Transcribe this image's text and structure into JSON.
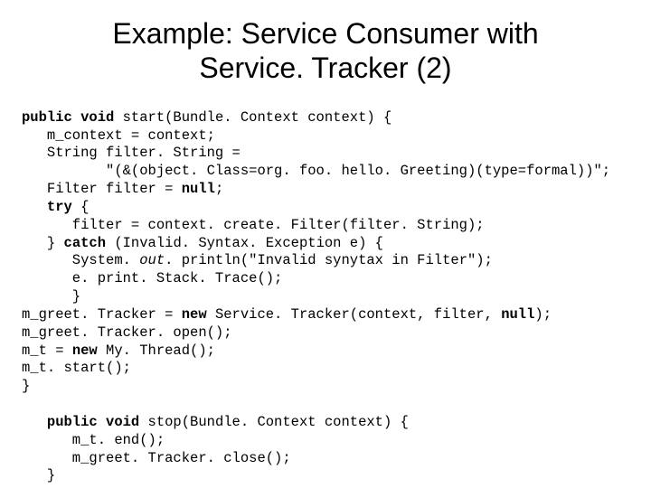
{
  "title_line1": "Example: Service Consumer with",
  "title_line2": "Service. Tracker (2)",
  "code": {
    "l01a": "public void ",
    "l01b": "start(Bundle. Context context) {",
    "l02": "   m_context = context;",
    "l03": "   String filter. String =",
    "l04": "          \"(&(object. Class=org. foo. hello. Greeting)(type=formal))\";",
    "l05a": "   Filter filter = ",
    "l05b": "null",
    "l05c": ";",
    "l06a": "   try",
    "l06b": " {",
    "l07": "      filter = context. create. Filter(filter. String);",
    "l08a": "   } ",
    "l08b": "catch",
    "l08c": " (Invalid. Syntax. Exception e) {",
    "l09a": "      System. ",
    "l09b": "out",
    "l09c": ". println(\"Invalid synytax in Filter\");",
    "l10": "      e. print. Stack. Trace();",
    "l11": "      }",
    "l12a": "m_greet. Tracker = ",
    "l12b": "new",
    "l12c": " Service. Tracker(context, filter, ",
    "l12d": "null",
    "l12e": ");",
    "l13": "m_greet. Tracker. open();",
    "l14a": "m_t = ",
    "l14b": "new",
    "l14c": " My. Thread();",
    "l15": "m_t. start();",
    "l16": "}",
    "l17": "",
    "l18a": "   public void ",
    "l18b": "stop(Bundle. Context context) {",
    "l19": "      m_t. end();",
    "l20": "      m_greet. Tracker. close();",
    "l21": "   }"
  }
}
